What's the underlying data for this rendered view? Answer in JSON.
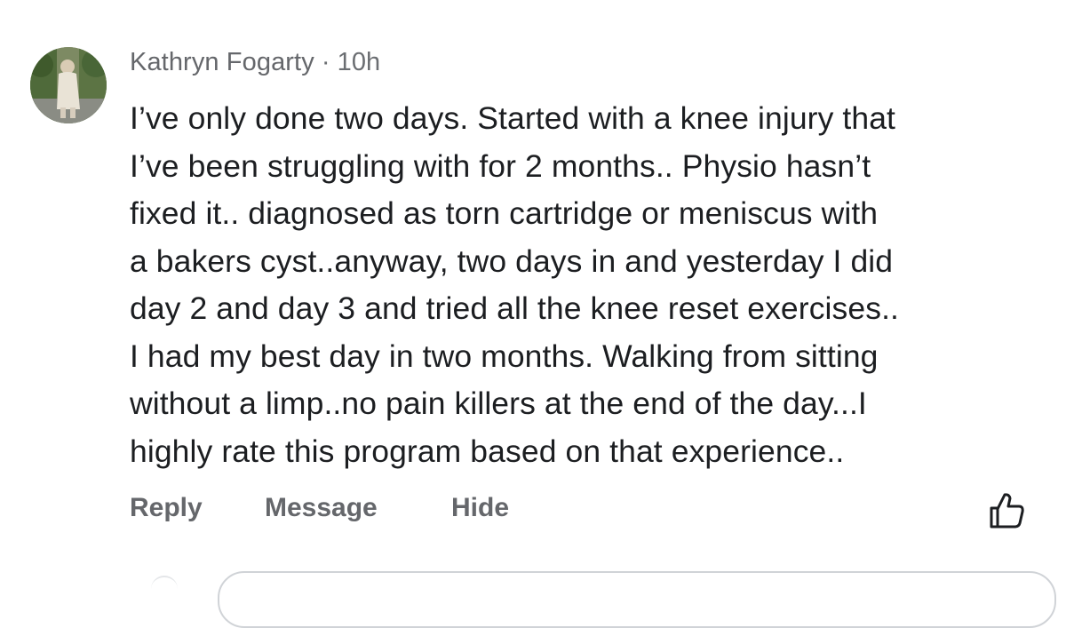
{
  "comment": {
    "author": "Kathryn Fogarty",
    "separator": "·",
    "time": "10h",
    "avatar_icon": "profile-photo",
    "lines": [
      "I’ve only done two days. Started with a knee injury that",
      "I’ve been struggling with for 2 months.. Physio hasn’t",
      "fixed it.. diagnosed as torn cartridge or meniscus with",
      "a bakers cyst..anyway, two days in and yesterday I did",
      "day 2 and day 3 and tried all the knee reset exercises..",
      "I had my best day in two months. Walking from sitting",
      "without a limp..no pain killers at the end of the day...I",
      "highly rate this program based on that experience.."
    ]
  },
  "actions": {
    "reply_label": "Reply",
    "message_label": "Message",
    "hide_label": "Hide",
    "like_icon": "thumbs-up-icon"
  },
  "colors": {
    "text": "#1c1e21",
    "secondary": "#65676b",
    "border": "#d0d3d7"
  }
}
